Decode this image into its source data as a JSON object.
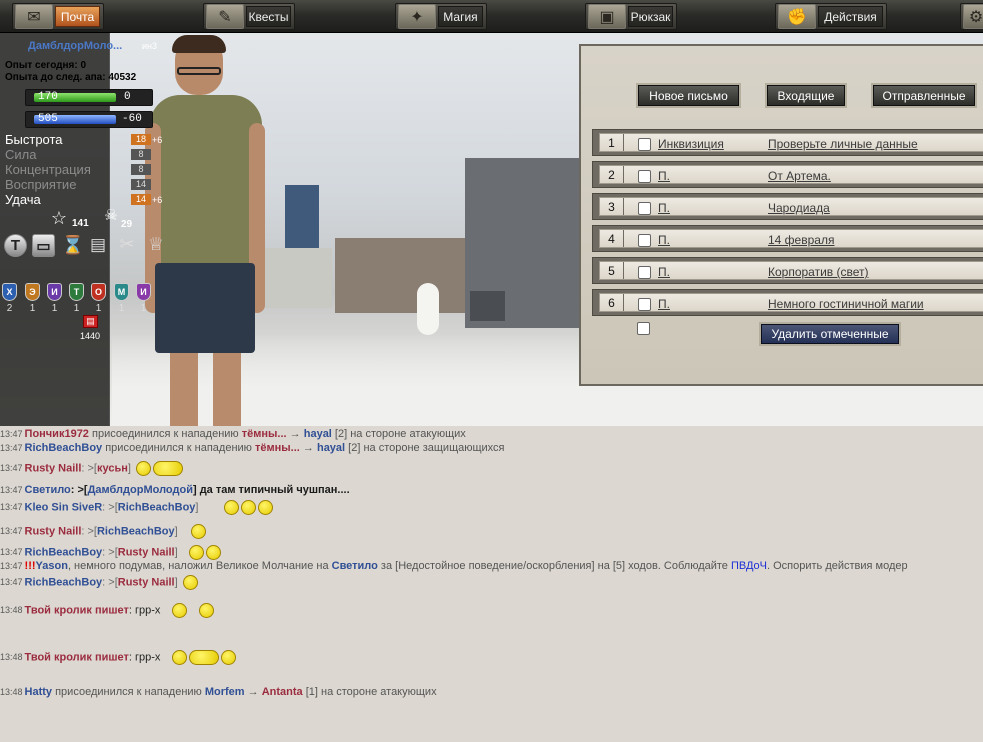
{
  "nav": {
    "items": [
      {
        "label": "Почта",
        "icon": "envelope-icon",
        "active": true
      },
      {
        "label": "Квесты",
        "icon": "quill-icon",
        "active": false
      },
      {
        "label": "Магия",
        "icon": "magic-wand-icon",
        "active": false
      },
      {
        "label": "Рюкзак",
        "icon": "backpack-icon",
        "active": false
      },
      {
        "label": "Действия",
        "icon": "fist-icon",
        "active": false
      }
    ]
  },
  "character": {
    "name": "ДамблдорМоло...",
    "level": "ин3",
    "xp_today": "Опыт сегодня: 0",
    "xp_next": "Опыта до след. апа: 40532",
    "hp": "170",
    "hp_right": "0",
    "mp": "505",
    "mp_right": "-60",
    "stats": [
      {
        "name": "Быстрота",
        "value": "18",
        "bonus": "+6",
        "active": true
      },
      {
        "name": "Сила",
        "value": "8",
        "bonus": "",
        "active": false
      },
      {
        "name": "Концентрация",
        "value": "8",
        "bonus": "",
        "active": false
      },
      {
        "name": "Восприятие",
        "value": "14",
        "bonus": "",
        "active": false
      },
      {
        "name": "Удача",
        "value": "14",
        "bonus": "+6",
        "active": true
      }
    ],
    "stars": "141",
    "skulls": "29",
    "shields": [
      {
        "letter": "Х",
        "count": "2",
        "color": "#2d5fb0"
      },
      {
        "letter": "Э",
        "count": "1",
        "color": "#c07820"
      },
      {
        "letter": "И",
        "count": "1",
        "color": "#6a3aa8"
      },
      {
        "letter": "Т",
        "count": "1",
        "color": "#2c7a3c"
      },
      {
        "letter": "О",
        "count": "1",
        "color": "#c03020"
      },
      {
        "letter": "М",
        "count": "1",
        "color": "#2a8a8a"
      },
      {
        "letter": "И",
        "count": "1",
        "color": "#8a3aa8"
      }
    ],
    "gold": "1440"
  },
  "mail": {
    "btn_new": "Новое письмо",
    "btn_inbox": "Входящие",
    "btn_sent": "Отправленные",
    "btn_delete": "Удалить отмеченные",
    "rows": [
      {
        "num": "1",
        "from": "Инквизиция",
        "subject": "Проверьте личные данные"
      },
      {
        "num": "2",
        "from": "П.",
        "subject": "От Артема."
      },
      {
        "num": "3",
        "from": "П.",
        "subject": "Чародиада"
      },
      {
        "num": "4",
        "from": "П.",
        "subject": "14 февраля"
      },
      {
        "num": "5",
        "from": "П.",
        "subject": "Корпоратив (свет)"
      },
      {
        "num": "6",
        "from": "П.",
        "subject": "Немного гостиничной магии"
      }
    ]
  },
  "chat": [
    {
      "time": "13:47",
      "a": "Пончик1972",
      "t1": " присоединился к нападению ",
      "b": "тёмны...",
      "t2": " → ",
      "c": "hayal",
      "t3": " [2] на стороне атакующих"
    },
    {
      "time": "13:47",
      "a": "RichBeachBoy",
      "t1": " присоединился к нападению ",
      "b": "тёмны...",
      "t2": " → ",
      "c": "hayal",
      "t3": " [2] на стороне защищающихся"
    },
    {
      "time": "13:47",
      "a": "Rusty Naill",
      "t1": ": >[",
      "b": "кусьн",
      "t2": "]"
    },
    {
      "time": "13:47",
      "a": "Светило",
      "t1": ": >[",
      "b": "ДамблдорМолодой",
      "t2": "]  да там типичный чушпан...."
    },
    {
      "time": "13:47",
      "a": "Kleo Sin SiveR",
      "t1": ": >[",
      "b": "RichBeachBoy",
      "t2": "]"
    },
    {
      "time": "13:47",
      "a": "Rusty Naill",
      "t1": ": >[",
      "b": "RichBeachBoy",
      "t2": "]"
    },
    {
      "time": "13:47",
      "a": "RichBeachBoy",
      "t1": ": >[",
      "b": "Rusty Naill",
      "t2": "]"
    },
    {
      "time": "13:47",
      "a": "!!!",
      "b": "Yason",
      "t1": ", немного подумав, наложил Великое Молчание на ",
      "c": "Светило",
      "t2": " за [Недостойное поведение/оскорбления] на [5] ходов. Соблюдайте ",
      "d": "ПВДоЧ",
      "t3": ". Оспорить действия модер"
    },
    {
      "time": "13:47",
      "a": "RichBeachBoy",
      "t1": ": >[",
      "b": "Rusty Naill",
      "t2": "]"
    },
    {
      "time": "13:48",
      "a": "Твой кролик пишет",
      "t1": ":  грр-х"
    },
    {
      "time": "13:48",
      "a": "Твой кролик пишет",
      "t1": ":  грр-х"
    },
    {
      "time": "13:48",
      "a": "Hatty",
      "t1": " присоединился к нападению ",
      "b": "Morfem",
      "t2": " → ",
      "c": "Antanta",
      "t3": " [1] на стороне атакующих"
    }
  ]
}
